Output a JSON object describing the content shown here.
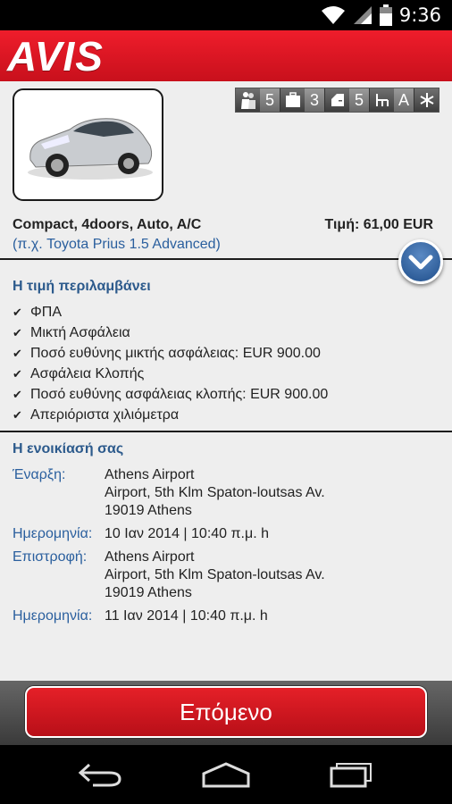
{
  "status_bar": {
    "time": "9:36",
    "icons": [
      "wifi-icon",
      "signal-icon",
      "battery-icon"
    ]
  },
  "header": {
    "logo_text": "AVIS",
    "brand_color": "#d8121f"
  },
  "car": {
    "image": "car-image (silver Toyota Prius)",
    "features": [
      {
        "icon": "passengers-icon",
        "value": "5"
      },
      {
        "icon": "luggage-icon",
        "value": "3"
      },
      {
        "icon": "doors-icon",
        "value": "5"
      },
      {
        "icon": "transmission-icon",
        "value": "A"
      },
      {
        "icon": "air-conditioning-icon",
        "value": ""
      }
    ],
    "title": "Compact, 4doors, Auto, A/C",
    "price": "Τιμή: 61,00 EUR",
    "example": "(π.χ. Toyota Prius 1.5 Advanced)"
  },
  "includes": {
    "title": "Η τιμή περιλαμβάνει",
    "items": [
      "ΦΠΑ",
      "Μικτή Ασφάλεια",
      "Ποσό ευθύνης μικτής ασφάλειας: EUR 900.00",
      "Ασφάλεια Κλοπής",
      "Ποσό ευθύνης ασφάλειας κλοπής: EUR 900.00",
      "Απεριόριστα χιλιόμετρα"
    ]
  },
  "rental": {
    "title": "Η ενοικίασή σας",
    "start_label": "Έναρξη:",
    "start_location": [
      "Athens Airport",
      "Airport, 5th Klm Spaton-loutsas Av.",
      "19019 Athens"
    ],
    "start_date_label": "Ημερομηνία:",
    "start_date": "10 Ιαν 2014 | 10:40 π.μ. h",
    "return_label": "Επιστροφή:",
    "return_location": [
      "Athens Airport",
      "Airport, 5th Klm Spaton-loutsas Av.",
      "19019 Athens"
    ],
    "return_date_label": "Ημερομηνία:",
    "return_date": "11 Ιαν 2014 | 10:40 π.μ. h"
  },
  "next_button": "Επόμενο",
  "nav": {
    "back": "back-icon",
    "home": "home-icon",
    "recents": "recents-icon"
  }
}
